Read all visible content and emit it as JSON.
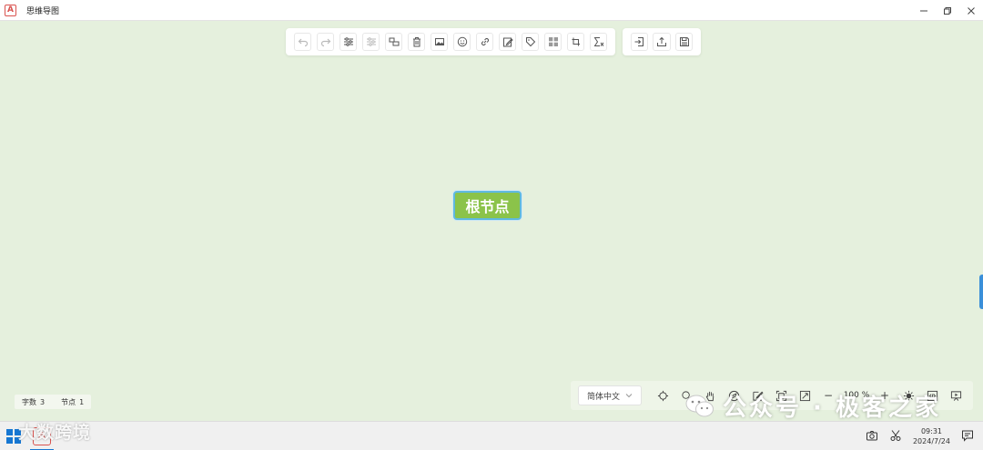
{
  "window": {
    "title": "思维导图",
    "app_icon": "app-logo",
    "controls": [
      "minimize-icon",
      "restore-icon",
      "close-icon"
    ]
  },
  "toolbar": {
    "main": [
      {
        "name": "undo",
        "icon": "undo-icon",
        "disabled": true
      },
      {
        "name": "redo",
        "icon": "redo-icon",
        "disabled": true
      },
      {
        "name": "insert-sibling",
        "icon": "sibling-node-icon",
        "disabled": false
      },
      {
        "name": "insert-child",
        "icon": "child-node-icon",
        "disabled": true
      },
      {
        "name": "insert-parent",
        "icon": "parent-node-icon",
        "disabled": false
      },
      {
        "name": "delete-node",
        "icon": "trash-icon",
        "disabled": false
      },
      {
        "name": "image",
        "icon": "image-icon",
        "disabled": false
      },
      {
        "name": "emoji",
        "icon": "emoji-icon",
        "disabled": false
      },
      {
        "name": "hyperlink",
        "icon": "link-icon",
        "disabled": false
      },
      {
        "name": "note",
        "icon": "note-icon",
        "disabled": false
      },
      {
        "name": "tag",
        "icon": "tag-icon",
        "disabled": false
      },
      {
        "name": "summary",
        "icon": "grid-icon",
        "disabled": false
      },
      {
        "name": "association",
        "icon": "connect-icon",
        "disabled": false
      },
      {
        "name": "formula",
        "icon": "formula-icon",
        "disabled": false
      }
    ],
    "io": [
      {
        "name": "import",
        "icon": "import-icon"
      },
      {
        "name": "export",
        "icon": "export-icon"
      },
      {
        "name": "save",
        "icon": "save-icon"
      }
    ]
  },
  "canvas": {
    "root_node": "根节点",
    "accent": "#8bc34a",
    "selection": "#5fb9e0"
  },
  "stats": {
    "words_label": "字数",
    "words_value": "3",
    "nodes_label": "节点",
    "nodes_value": "1"
  },
  "bottom_bar": {
    "language": "简体中文",
    "zoom": "100 %",
    "tools": [
      "locate-icon",
      "search-icon",
      "hand-icon",
      "navigator-icon",
      "edit-icon",
      "fit-icon",
      "fullscreen-icon"
    ],
    "zoom_out": "−",
    "zoom_in": "+",
    "extra": [
      "theme-icon",
      "code-icon",
      "present-icon"
    ]
  },
  "taskbar": {
    "watermark_left": "大数跨境",
    "time": "09:31",
    "date": "2024/7/24"
  },
  "watermark_right": "公众号 · 极客之家"
}
